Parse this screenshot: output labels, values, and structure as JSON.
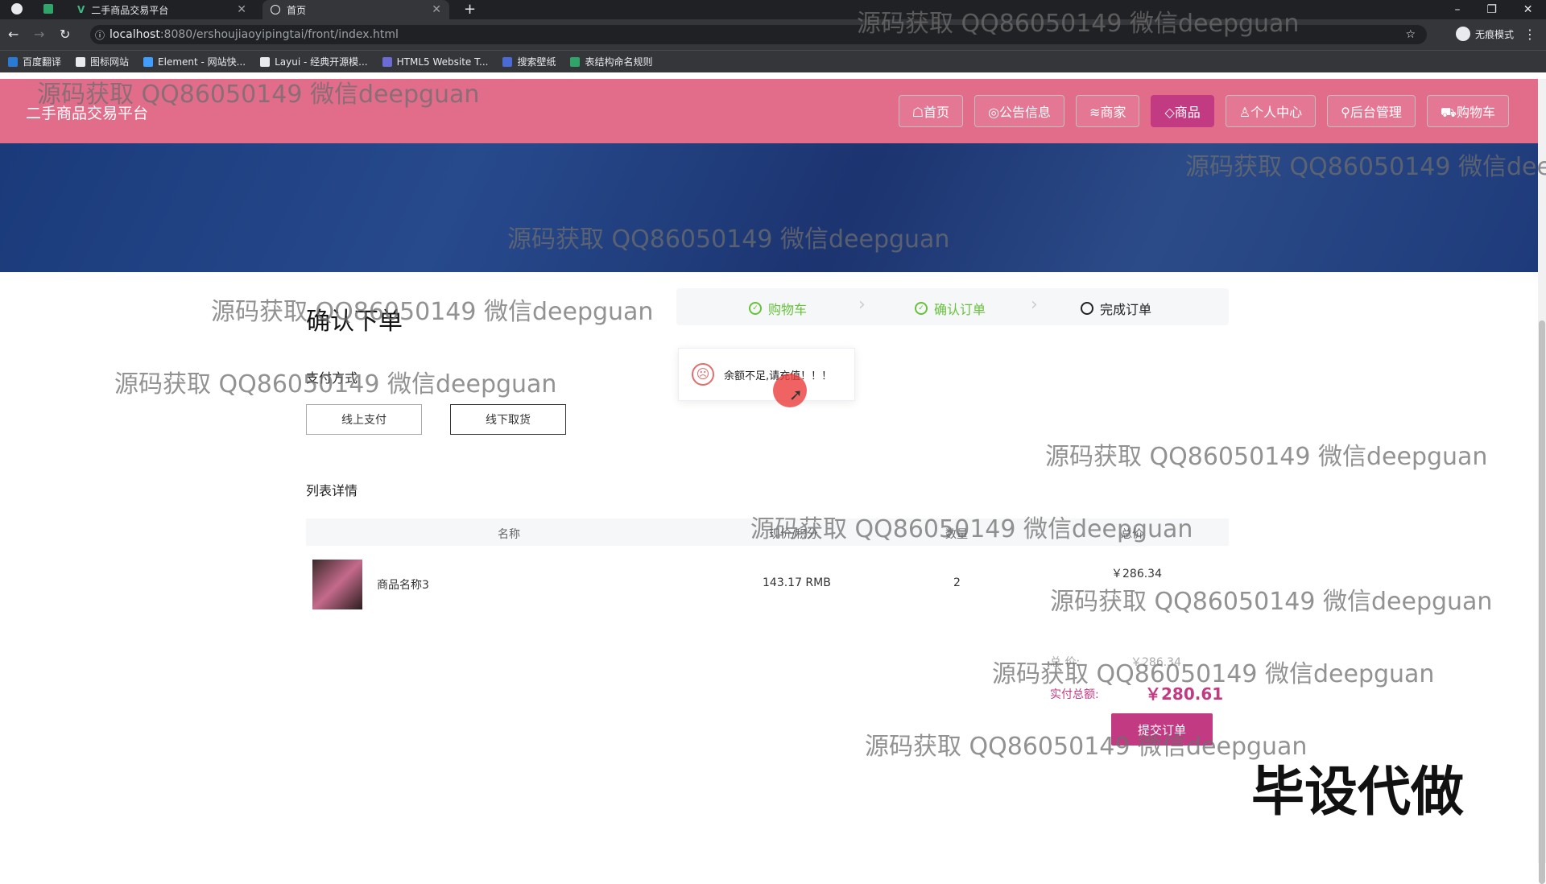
{
  "browser": {
    "tabs": [
      {
        "label": "二手商品交易平台"
      },
      {
        "label": "首页"
      }
    ],
    "new_tab": "+",
    "url_host": "localhost",
    "url_path": ":8080/ershoujiaoyipingtai/front/index.html",
    "profile_label": "无痕模式",
    "bookmarks": [
      {
        "label": "百度翻译",
        "color": "#2a7bd6"
      },
      {
        "label": "图标网站",
        "color": "#e8eaed"
      },
      {
        "label": "Element - 网站快...",
        "color": "#409eff"
      },
      {
        "label": "Layui - 经典开源模...",
        "color": "#e8eaed"
      },
      {
        "label": "HTML5 Website T...",
        "color": "#6b6bd6"
      },
      {
        "label": "搜索壁纸",
        "color": "#4a6ad6"
      },
      {
        "label": "表结构命名规则",
        "color": "#2fa56a"
      }
    ]
  },
  "site": {
    "title": "二手商品交易平台",
    "nav": [
      {
        "label": "☖首页"
      },
      {
        "label": "◎公告信息"
      },
      {
        "label": "≋商家"
      },
      {
        "label": "◇商品",
        "active": true
      },
      {
        "label": "♙个人中心"
      },
      {
        "label": "⚲后台管理"
      },
      {
        "label": "⛟购物车"
      }
    ]
  },
  "order": {
    "title": "确认下单",
    "steps": [
      {
        "label": "购物车",
        "state": "done"
      },
      {
        "label": "确认订单",
        "state": "done"
      },
      {
        "label": "完成订单",
        "state": "current"
      }
    ],
    "toast": "余额不足,请充值！！！",
    "payment_label": "支付方式",
    "payment_options": [
      "线上支付",
      "线下取货"
    ],
    "list_label": "列表详情",
    "columns": [
      "名称",
      "现价/积分",
      "数量",
      "总价"
    ],
    "rows": [
      {
        "name": "商品名称3",
        "price": "143.17 RMB",
        "qty": "2",
        "total": "￥286.34"
      }
    ],
    "sum_label": "总 价:",
    "sum_value": "￥286.34",
    "total_label": "实付总额:",
    "total_value": "￥280.61",
    "submit": "提交订单"
  },
  "corner_text": "毕设代做",
  "watermark": "源码获取 QQ86050149 微信deepguan",
  "accent_color": "#c23b82",
  "header_color": "#e26d8b"
}
